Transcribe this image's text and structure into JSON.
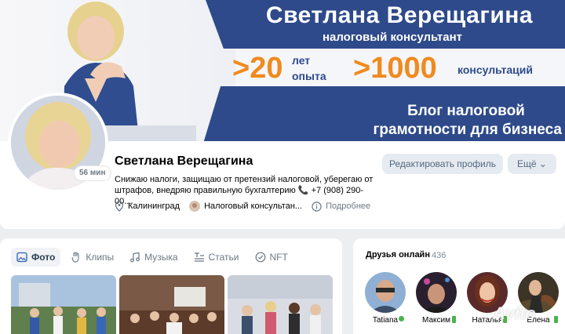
{
  "cover": {
    "name": "Светлана Верещагина",
    "subtitle": "налоговый консультант",
    "stat1_value": ">20",
    "stat1_label_line1": "лет",
    "stat1_label_line2": "опыта",
    "stat2_value": ">1000",
    "stat2_label": "консультаций",
    "blog_line1": "Блог налоговой",
    "blog_line2": "грамотности для бизнеса",
    "colors": {
      "navy": "#2e4a8a",
      "orange": "#f08a1e"
    }
  },
  "profile": {
    "last_seen_badge": "56 мин",
    "name": "Светлана Верещагина",
    "status": "Снижаю налоги, защищаю от претензий налоговой, уберегаю от штрафов, внедряю правильную бухгалтерию 📞 +7 (908) 290-00...",
    "city": "Калининград",
    "job": "Налоговый консультан...",
    "more_info": "Подробнее",
    "edit_button": "Редактировать профиль",
    "more_button": "Ещё ⌄"
  },
  "tabs": [
    {
      "label": "Фото",
      "icon": "photo-icon",
      "active": true
    },
    {
      "label": "Клипы",
      "icon": "clips-icon",
      "active": false
    },
    {
      "label": "Музыка",
      "icon": "music-icon",
      "active": false
    },
    {
      "label": "Статьи",
      "icon": "articles-icon",
      "active": false
    },
    {
      "label": "NFT",
      "icon": "nft-icon",
      "active": false
    }
  ],
  "friends": {
    "title": "Друзья онлайн",
    "count": "436",
    "items": [
      {
        "name": "Tatiana",
        "online": "web"
      },
      {
        "name": "Максим",
        "online": "mobile"
      },
      {
        "name": "Наталья",
        "online": "mobile"
      },
      {
        "name": "Елена",
        "online": "mobile"
      }
    ]
  },
  "watermark": "Avito"
}
